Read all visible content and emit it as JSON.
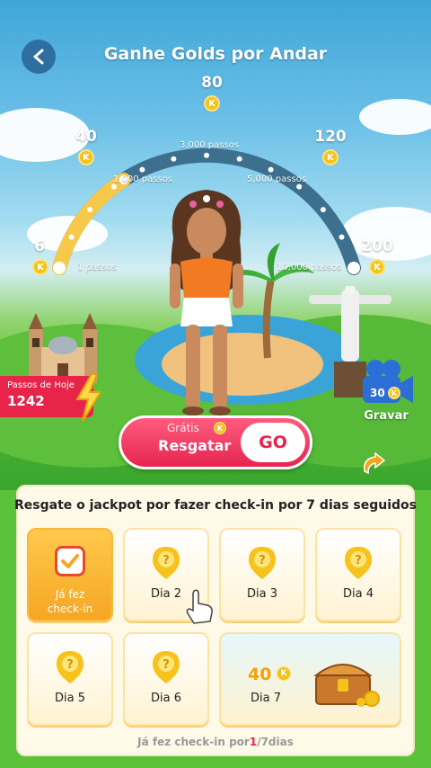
{
  "header": {
    "title": "Ganhe Golds por Andar",
    "back_label": "voltar"
  },
  "gauge": {
    "milestones": [
      {
        "reward": "6",
        "steps": "1 passos"
      },
      {
        "reward": "40",
        "steps": "1,000 passos"
      },
      {
        "reward": "80",
        "steps": "3,000 passos"
      },
      {
        "reward": "120",
        "steps": "5,000 passos"
      },
      {
        "reward": "200",
        "steps": "10,000 passos"
      }
    ],
    "progress_fraction": 0.28,
    "coin_symbol": "K"
  },
  "today": {
    "label": "Passos de Hoje",
    "value": "1242"
  },
  "record": {
    "count": "30",
    "label": "Gravar"
  },
  "claim": {
    "free_label": "Grátis",
    "coin_symbol": "K",
    "claim_label": "Resgatar",
    "go_label": "GO"
  },
  "checkin": {
    "title": "Resgate o jackpot por fazer check-in por 7 dias seguidos",
    "days": [
      {
        "label": "Já fez check-in",
        "state": "done"
      },
      {
        "label": "Dia 2",
        "state": "locked"
      },
      {
        "label": "Dia 3",
        "state": "locked"
      },
      {
        "label": "Dia 4",
        "state": "locked"
      },
      {
        "label": "Dia 5",
        "state": "locked"
      },
      {
        "label": "Dia 6",
        "state": "locked"
      },
      {
        "label": "Dia 7",
        "state": "jackpot",
        "reward": "40"
      }
    ],
    "footer_prefix": "Já fez check-in por",
    "footer_current": "1",
    "footer_suffix": "/7dias"
  },
  "colors": {
    "accent": "#e6244f",
    "gold": "#f3c21c",
    "progress": "#f6c94a",
    "track": "#3d6f8f"
  }
}
